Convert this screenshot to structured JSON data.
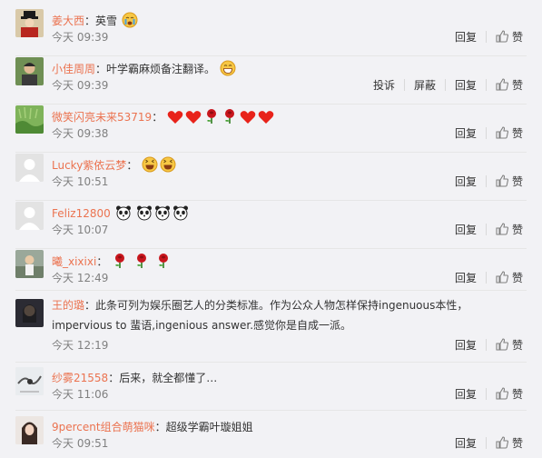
{
  "comments": [
    {
      "user": "姜大西",
      "colon": "：",
      "text": "英雪",
      "emoji": [
        "crying-face"
      ],
      "time": "今天 09:39",
      "actions": [
        "回复",
        "赞"
      ]
    },
    {
      "user": "小佳周周",
      "colon": "：",
      "text": "叶学霸麻烦备注翻译。",
      "emoji": [
        "grin-face"
      ],
      "time": "今天 09:39",
      "actions": [
        "投诉",
        "屏蔽",
        "回复",
        "赞"
      ]
    },
    {
      "user": "微笑闪亮未来53719",
      "colon": "：",
      "text": "",
      "emoji": [
        "heart",
        "heart",
        "rose",
        "rose",
        "heart",
        "heart"
      ],
      "time": "今天 09:38",
      "actions": [
        "回复",
        "赞"
      ]
    },
    {
      "user": "Lucky紫依云梦",
      "colon": "：",
      "text": "",
      "emoji": [
        "haha-face",
        "haha-face"
      ],
      "time": "今天 10:51",
      "actions": [
        "回复",
        "赞"
      ]
    },
    {
      "user": "Feliz12800",
      "colon": "",
      "text": "",
      "emoji": [
        "panda",
        "panda",
        "panda",
        "panda"
      ],
      "time": "今天 10:07",
      "actions": [
        "回复",
        "赞"
      ]
    },
    {
      "user": "曦_xixixi",
      "colon": "：",
      "text": "",
      "emoji": [
        "rose",
        "rose",
        "rose"
      ],
      "time": "今天 12:49",
      "actions": [
        "回复",
        "赞"
      ]
    },
    {
      "user": "王的璐",
      "colon": "：",
      "text": "此条可列为娱乐圈艺人的分类标准。作为公众人物怎样保持ingenuous本性，impervious to 蜚语,ingenious answer.感觉你是自成一派。",
      "emoji": [],
      "time": "今天 12:19",
      "actions": [
        "回复",
        "赞"
      ]
    },
    {
      "user": "纱雾21558",
      "colon": "：",
      "text": "后来，就全都懂了…",
      "emoji": [],
      "time": "今天 11:06",
      "actions": [
        "回复",
        "赞"
      ]
    },
    {
      "user": "9percent组合萌猫咪",
      "colon": "：",
      "text": "超级学霸叶璇姐姐",
      "emoji": [],
      "time": "今天 09:51",
      "actions": [
        "回复",
        "赞"
      ]
    }
  ],
  "colors": {
    "username": "#eb7350",
    "time": "#808080",
    "divider": "#e6e6e6",
    "background": "#f2f2f5"
  }
}
